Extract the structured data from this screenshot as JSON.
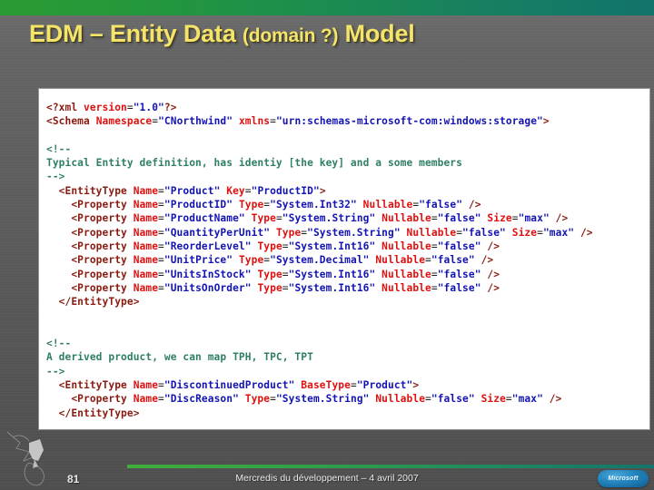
{
  "slide": {
    "title_main_1": "EDM – Entity Data ",
    "title_small": "(domain ?)",
    "title_main_2": " Model"
  },
  "code": {
    "lines": [
      [
        {
          "t": "pi",
          "s": "<?xml "
        },
        {
          "t": "att",
          "s": "version"
        },
        {
          "t": "eq",
          "s": "="
        },
        {
          "t": "val",
          "s": "\"1.0\""
        },
        {
          "t": "pi",
          "s": "?>"
        }
      ],
      [
        {
          "t": "tag",
          "s": "<Schema "
        },
        {
          "t": "att",
          "s": "Namespace"
        },
        {
          "t": "eq",
          "s": "="
        },
        {
          "t": "val",
          "s": "\"CNorthwind\""
        },
        {
          "t": "pln",
          "s": " "
        },
        {
          "t": "att",
          "s": "xmlns"
        },
        {
          "t": "eq",
          "s": "="
        },
        {
          "t": "val",
          "s": "\"urn:schemas-microsoft-com:windows:storage\""
        },
        {
          "t": "tag",
          "s": ">"
        }
      ],
      [
        {
          "t": "pln",
          "s": ""
        }
      ],
      [
        {
          "t": "cmt",
          "s": "<!--"
        }
      ],
      [
        {
          "t": "cmt",
          "s": "Typical Entity definition, has identiy [the key] and a some members"
        }
      ],
      [
        {
          "t": "cmt",
          "s": "-->"
        }
      ],
      [
        {
          "t": "tag",
          "s": "  <EntityType "
        },
        {
          "t": "att",
          "s": "Name"
        },
        {
          "t": "eq",
          "s": "="
        },
        {
          "t": "val",
          "s": "\"Product\""
        },
        {
          "t": "pln",
          "s": " "
        },
        {
          "t": "att",
          "s": "Key"
        },
        {
          "t": "eq",
          "s": "="
        },
        {
          "t": "val",
          "s": "\"ProductID\""
        },
        {
          "t": "tag",
          "s": ">"
        }
      ],
      [
        {
          "t": "tag",
          "s": "    <Property "
        },
        {
          "t": "att",
          "s": "Name"
        },
        {
          "t": "eq",
          "s": "="
        },
        {
          "t": "val",
          "s": "\"ProductID\""
        },
        {
          "t": "pln",
          "s": " "
        },
        {
          "t": "att",
          "s": "Type"
        },
        {
          "t": "eq",
          "s": "="
        },
        {
          "t": "val",
          "s": "\"System.Int32\""
        },
        {
          "t": "pln",
          "s": " "
        },
        {
          "t": "att",
          "s": "Nullable"
        },
        {
          "t": "eq",
          "s": "="
        },
        {
          "t": "val",
          "s": "\"false\""
        },
        {
          "t": "tag",
          "s": " />"
        }
      ],
      [
        {
          "t": "tag",
          "s": "    <Property "
        },
        {
          "t": "att",
          "s": "Name"
        },
        {
          "t": "eq",
          "s": "="
        },
        {
          "t": "val",
          "s": "\"ProductName\""
        },
        {
          "t": "pln",
          "s": " "
        },
        {
          "t": "att",
          "s": "Type"
        },
        {
          "t": "eq",
          "s": "="
        },
        {
          "t": "val",
          "s": "\"System.String\""
        },
        {
          "t": "pln",
          "s": " "
        },
        {
          "t": "att",
          "s": "Nullable"
        },
        {
          "t": "eq",
          "s": "="
        },
        {
          "t": "val",
          "s": "\"false\""
        },
        {
          "t": "pln",
          "s": " "
        },
        {
          "t": "att",
          "s": "Size"
        },
        {
          "t": "eq",
          "s": "="
        },
        {
          "t": "val",
          "s": "\"max\""
        },
        {
          "t": "tag",
          "s": " />"
        }
      ],
      [
        {
          "t": "tag",
          "s": "    <Property "
        },
        {
          "t": "att",
          "s": "Name"
        },
        {
          "t": "eq",
          "s": "="
        },
        {
          "t": "val",
          "s": "\"QuantityPerUnit\""
        },
        {
          "t": "pln",
          "s": " "
        },
        {
          "t": "att",
          "s": "Type"
        },
        {
          "t": "eq",
          "s": "="
        },
        {
          "t": "val",
          "s": "\"System.String\""
        },
        {
          "t": "pln",
          "s": " "
        },
        {
          "t": "att",
          "s": "Nullable"
        },
        {
          "t": "eq",
          "s": "="
        },
        {
          "t": "val",
          "s": "\"false\""
        },
        {
          "t": "pln",
          "s": " "
        },
        {
          "t": "att",
          "s": "Size"
        },
        {
          "t": "eq",
          "s": "="
        },
        {
          "t": "val",
          "s": "\"max\""
        },
        {
          "t": "tag",
          "s": " />"
        }
      ],
      [
        {
          "t": "tag",
          "s": "    <Property "
        },
        {
          "t": "att",
          "s": "Name"
        },
        {
          "t": "eq",
          "s": "="
        },
        {
          "t": "val",
          "s": "\"ReorderLevel\""
        },
        {
          "t": "pln",
          "s": " "
        },
        {
          "t": "att",
          "s": "Type"
        },
        {
          "t": "eq",
          "s": "="
        },
        {
          "t": "val",
          "s": "\"System.Int16\""
        },
        {
          "t": "pln",
          "s": " "
        },
        {
          "t": "att",
          "s": "Nullable"
        },
        {
          "t": "eq",
          "s": "="
        },
        {
          "t": "val",
          "s": "\"false\""
        },
        {
          "t": "tag",
          "s": " />"
        }
      ],
      [
        {
          "t": "tag",
          "s": "    <Property "
        },
        {
          "t": "att",
          "s": "Name"
        },
        {
          "t": "eq",
          "s": "="
        },
        {
          "t": "val",
          "s": "\"UnitPrice\""
        },
        {
          "t": "pln",
          "s": " "
        },
        {
          "t": "att",
          "s": "Type"
        },
        {
          "t": "eq",
          "s": "="
        },
        {
          "t": "val",
          "s": "\"System.Decimal\""
        },
        {
          "t": "pln",
          "s": " "
        },
        {
          "t": "att",
          "s": "Nullable"
        },
        {
          "t": "eq",
          "s": "="
        },
        {
          "t": "val",
          "s": "\"false\""
        },
        {
          "t": "tag",
          "s": " />"
        }
      ],
      [
        {
          "t": "tag",
          "s": "    <Property "
        },
        {
          "t": "att",
          "s": "Name"
        },
        {
          "t": "eq",
          "s": "="
        },
        {
          "t": "val",
          "s": "\"UnitsInStock\""
        },
        {
          "t": "pln",
          "s": " "
        },
        {
          "t": "att",
          "s": "Type"
        },
        {
          "t": "eq",
          "s": "="
        },
        {
          "t": "val",
          "s": "\"System.Int16\""
        },
        {
          "t": "pln",
          "s": " "
        },
        {
          "t": "att",
          "s": "Nullable"
        },
        {
          "t": "eq",
          "s": "="
        },
        {
          "t": "val",
          "s": "\"false\""
        },
        {
          "t": "tag",
          "s": " />"
        }
      ],
      [
        {
          "t": "tag",
          "s": "    <Property "
        },
        {
          "t": "att",
          "s": "Name"
        },
        {
          "t": "eq",
          "s": "="
        },
        {
          "t": "val",
          "s": "\"UnitsOnOrder\""
        },
        {
          "t": "pln",
          "s": " "
        },
        {
          "t": "att",
          "s": "Type"
        },
        {
          "t": "eq",
          "s": "="
        },
        {
          "t": "val",
          "s": "\"System.Int16\""
        },
        {
          "t": "pln",
          "s": " "
        },
        {
          "t": "att",
          "s": "Nullable"
        },
        {
          "t": "eq",
          "s": "="
        },
        {
          "t": "val",
          "s": "\"false\""
        },
        {
          "t": "tag",
          "s": " />"
        }
      ],
      [
        {
          "t": "tag",
          "s": "  </EntityType>"
        }
      ],
      [
        {
          "t": "pln",
          "s": ""
        }
      ],
      [
        {
          "t": "pln",
          "s": ""
        }
      ],
      [
        {
          "t": "cmt",
          "s": "<!--"
        }
      ],
      [
        {
          "t": "cmt",
          "s": "A derived product, we can map TPH, TPC, TPT"
        }
      ],
      [
        {
          "t": "cmt",
          "s": "-->"
        }
      ],
      [
        {
          "t": "tag",
          "s": "  <EntityType "
        },
        {
          "t": "att",
          "s": "Name"
        },
        {
          "t": "eq",
          "s": "="
        },
        {
          "t": "val",
          "s": "\"DiscontinuedProduct\""
        },
        {
          "t": "pln",
          "s": " "
        },
        {
          "t": "att",
          "s": "BaseType"
        },
        {
          "t": "eq",
          "s": "="
        },
        {
          "t": "val",
          "s": "\"Product\""
        },
        {
          "t": "tag",
          "s": ">"
        }
      ],
      [
        {
          "t": "tag",
          "s": "    <Property "
        },
        {
          "t": "att",
          "s": "Name"
        },
        {
          "t": "eq",
          "s": "="
        },
        {
          "t": "val",
          "s": "\"DiscReason\""
        },
        {
          "t": "pln",
          "s": " "
        },
        {
          "t": "att",
          "s": "Type"
        },
        {
          "t": "eq",
          "s": "="
        },
        {
          "t": "val",
          "s": "\"System.String\""
        },
        {
          "t": "pln",
          "s": " "
        },
        {
          "t": "att",
          "s": "Nullable"
        },
        {
          "t": "eq",
          "s": "="
        },
        {
          "t": "val",
          "s": "\"false\""
        },
        {
          "t": "pln",
          "s": " "
        },
        {
          "t": "att",
          "s": "Size"
        },
        {
          "t": "eq",
          "s": "="
        },
        {
          "t": "val",
          "s": "\"max\""
        },
        {
          "t": "tag",
          "s": " />"
        }
      ],
      [
        {
          "t": "tag",
          "s": "  </EntityType>"
        }
      ],
      [
        {
          "t": "pln",
          "s": ""
        }
      ],
      [
        {
          "t": "pln",
          "s": ""
        }
      ],
      [
        {
          "t": "cmt",
          "s": "<!--"
        }
      ]
    ]
  },
  "footer": {
    "slide_number": "81",
    "note": "Mercredis du développement – 4 avril 2007",
    "logo_label": "Microsoft"
  },
  "colors": {
    "title": "#f5e46a",
    "accent_green": "#2a9b34",
    "accent_teal": "#14756b",
    "background": "#5c5c5c",
    "code_bg": "#ffffff",
    "xml_tag": "#8b1a10",
    "xml_attribute": "#e01010",
    "xml_value": "#1414b4",
    "xml_comment": "#2f7f63",
    "ms_logo_blue": "#2283bb"
  }
}
